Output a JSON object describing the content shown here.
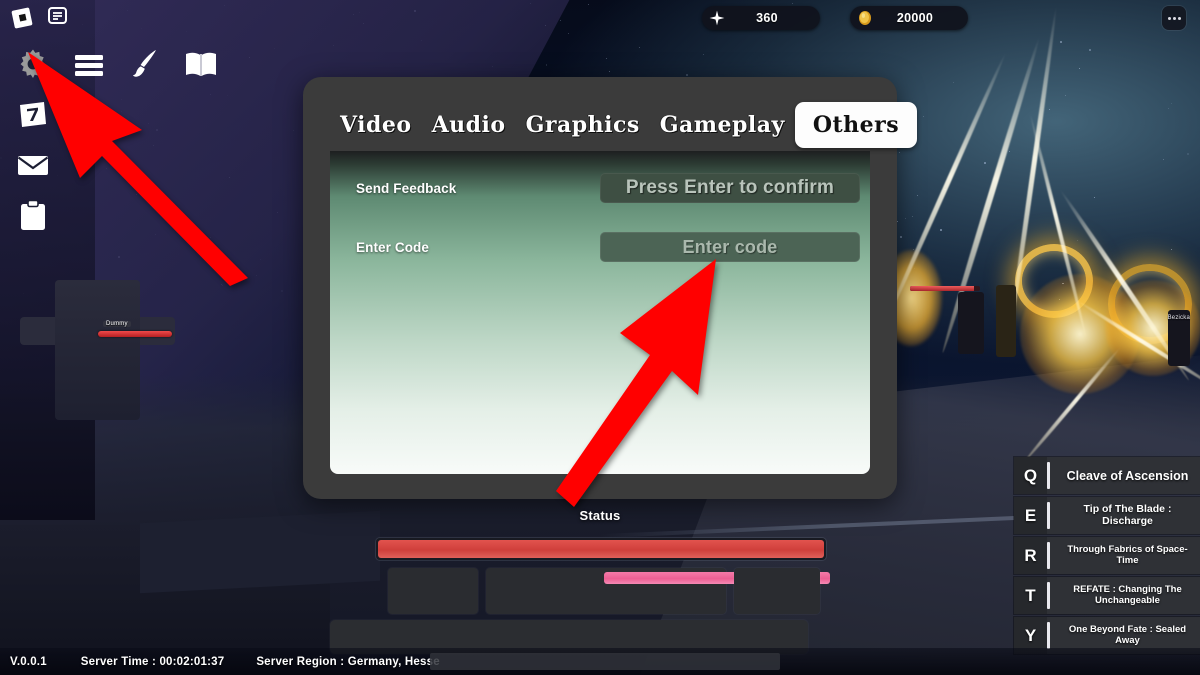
{
  "topbar": {
    "gem": {
      "icon": "gem-icon",
      "value": "360"
    },
    "gold": {
      "icon": "coin-icon",
      "value": "20000"
    },
    "more_menu": "more-options-icon"
  },
  "roblox_bar": {
    "logo": "roblox-logo-icon",
    "chat": "chat-icon"
  },
  "sidebar": {
    "items": [
      {
        "name": "settings-gear-icon",
        "label": "Settings"
      },
      {
        "name": "menu-icon",
        "label": "Menu"
      },
      {
        "name": "quill-brush-icon",
        "label": "Customize"
      },
      {
        "name": "book-icon",
        "label": "Codex"
      },
      {
        "name": "calendar-icon",
        "label": "Daily"
      },
      {
        "name": "mail-envelope-icon",
        "label": "Mail"
      },
      {
        "name": "clipboard-icon",
        "label": "Quests"
      }
    ]
  },
  "settings_modal": {
    "tabs": [
      {
        "label": "Video",
        "active": false
      },
      {
        "label": "Audio",
        "active": false
      },
      {
        "label": "Graphics",
        "active": false
      },
      {
        "label": "Gameplay",
        "active": false
      },
      {
        "label": "Others",
        "active": true
      }
    ],
    "rows": [
      {
        "label": "Send Feedback",
        "field_value": "Press Enter to confirm"
      },
      {
        "label": "Enter Code",
        "field_value": "Enter code"
      }
    ]
  },
  "hud": {
    "status_label": "Status",
    "health_percent": 100,
    "secondary_bar_percent": 94
  },
  "abilities": [
    {
      "key": "Q",
      "name": "Cleave of Ascension",
      "size": "big"
    },
    {
      "key": "E",
      "name": "Tip of The Blade : Discharge",
      "size": "mid"
    },
    {
      "key": "R",
      "name": "Through Fabrics of Space-Time",
      "size": "sm"
    },
    {
      "key": "T",
      "name": "REFATE : Changing The Unchangeable",
      "size": "sm"
    },
    {
      "key": "Y",
      "name": "One Beyond Fate : Sealed Away",
      "size": "sm"
    }
  ],
  "world": {
    "dummy_name": "Dummy",
    "enemy_name": "Bezicka"
  },
  "footer": {
    "version": "V.0.0.1",
    "server_time": "Server Time : 00:02:01:37",
    "server_region": "Server Region : Germany, Hesse"
  },
  "colors": {
    "accent_red": "#ff0000",
    "panel_green_top": "#5e8a72",
    "panel_green_bottom": "#f8fbf9",
    "modal_frame": "#3b3b3b",
    "health_red": "#cf3f3b",
    "secondary_pink": "#ec5f93",
    "gold": "#e8b33a"
  }
}
